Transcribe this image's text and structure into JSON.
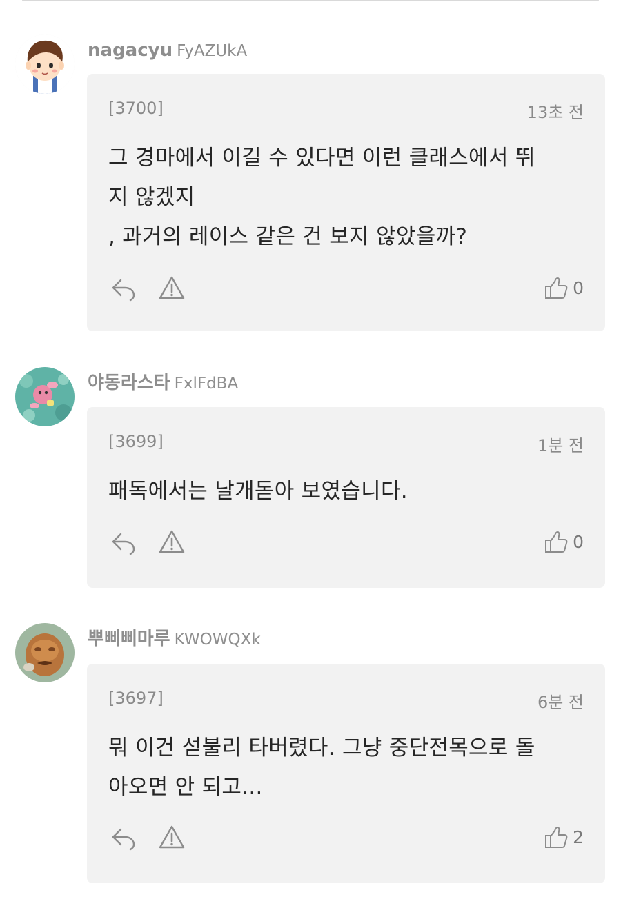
{
  "comments": [
    {
      "username": "nagacyu",
      "user_id": "FyAZUkA",
      "avatar_icon": "boy-face-avatar-icon",
      "number": "[3700]",
      "time": "13초 전",
      "text": "그 경마에서 이길 수 있다면 이런 클래스에서 뛰\n지 않겠지\n, 과거의 레이스 같은 건 보지 않았을까?",
      "likes": "0"
    },
    {
      "username": "야동라스타",
      "user_id": "FxlFdBA",
      "avatar_icon": "pink-creature-avatar-icon",
      "number": "[3699]",
      "time": "1분 전",
      "text": "패독에서는 날개돋아 보였습니다.",
      "likes": "0"
    },
    {
      "username": "뿌삐삐마루",
      "user_id": "KWOWQXk",
      "avatar_icon": "brown-face-avatar-icon",
      "number": "[3697]",
      "time": "6분 전",
      "text": "뭐 이건 섣불리 타버렸다. 그냥 중단전목으로 돌\n아오면 안 되고...",
      "likes": "2"
    }
  ],
  "icons": {
    "reply": "reply-icon",
    "report": "warning-icon",
    "like": "thumbs-up-icon"
  },
  "colors": {
    "bubble_background": "#f2f2f2",
    "username": "#8e8e8e",
    "meta_text": "#8a8a8a",
    "body_text": "#262626"
  }
}
